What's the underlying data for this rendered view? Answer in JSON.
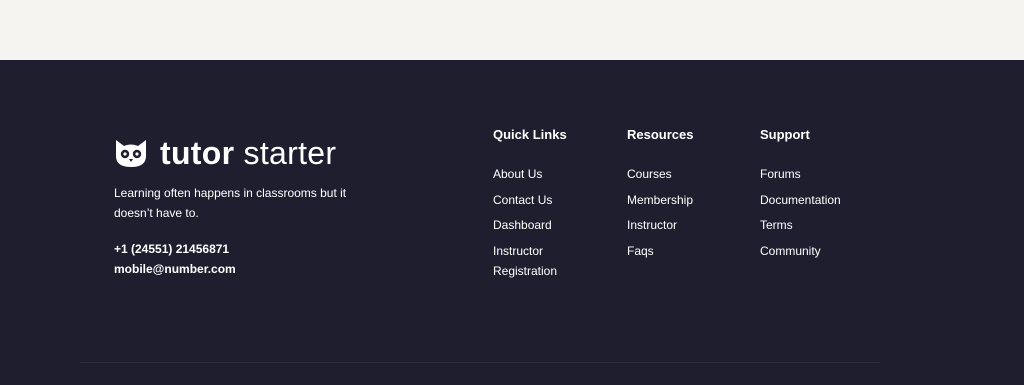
{
  "brand": {
    "logo_bold": "tutor",
    "logo_light": " starter",
    "tagline": "Learning often happens in classrooms but it doesn’t have to.",
    "phone": "+1 (24551) 21456871",
    "email": "mobile@number.com"
  },
  "columns": {
    "quick_links": {
      "title": "Quick Links",
      "items": [
        "About Us",
        "Contact Us",
        "Dashboard",
        "Instructor Registration"
      ]
    },
    "resources": {
      "title": "Resources",
      "items": [
        "Courses",
        "Membership",
        "Instructor",
        "Faqs"
      ]
    },
    "support": {
      "title": "Support",
      "items": [
        "Forums",
        "Documentation",
        "Terms",
        "Community"
      ]
    }
  },
  "colors": {
    "footer_bg": "#1f1e2f",
    "top_bg": "#f6f4f1",
    "text": "#ffffff"
  },
  "icons": {
    "logo": "owl-icon"
  }
}
